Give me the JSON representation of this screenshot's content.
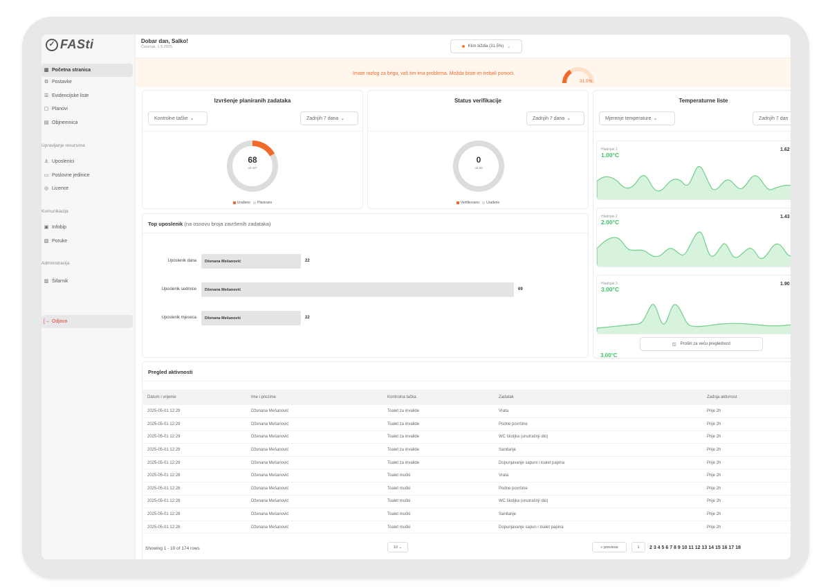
{
  "app": {
    "logo_text": "FASti",
    "logo_mark": "✓"
  },
  "sidebar": {
    "items": [
      {
        "label": "Početna stranica",
        "icon": "home-icon"
      },
      {
        "label": "Postavke",
        "icon": "gear-icon"
      },
      {
        "label": "Evidencijske liste",
        "icon": "list-icon"
      },
      {
        "label": "Planovi",
        "icon": "calendar-icon"
      },
      {
        "label": "Objnemnica",
        "icon": "document-icon"
      }
    ],
    "section_resources": "Upravljanje resursima",
    "resources": [
      {
        "label": "Uposlenici",
        "icon": "users-icon"
      },
      {
        "label": "Poslovne jedinice",
        "icon": "building-icon"
      },
      {
        "label": "Licence",
        "icon": "license-icon"
      }
    ],
    "section_comm": "Komunikacija",
    "comm": [
      {
        "label": "Infobip",
        "icon": "chat-icon"
      },
      {
        "label": "Poruke",
        "icon": "message-icon"
      }
    ],
    "section_admin": "Administracija",
    "admin": [
      {
        "label": "Šifarnik",
        "icon": "barcode-icon"
      }
    ],
    "logout": "Odjava"
  },
  "header": {
    "greeting": "Dobar dan, Salko!",
    "date": "Četvrtak, 1.5.2025.",
    "climate": "Klim tiiždia (31.5%)"
  },
  "alert": {
    "text": "Imate razlog za brigu, vaš tim ima problema. Možda biste im trebali pomoći.",
    "percent_label": "31.5%",
    "percent": 31.5,
    "color": "#f26a2a"
  },
  "card_tasks": {
    "title": "Izvršenje planiranih zadataka",
    "filter1": "Kontrolne tačke",
    "filter2": "Zadnjih 7 dana",
    "value": "68",
    "sub": "od 407",
    "done": 68,
    "total": 407,
    "legend1": "Urađeno",
    "legend2": "Planirano"
  },
  "card_verify": {
    "title": "Status verifikacije",
    "filter": "Zadnjih 7 dana",
    "value": "0",
    "sub": "od 68",
    "legend1": "Verifikovano",
    "legend2": "Urađeno"
  },
  "card_temp": {
    "title": "Temperaturne liste",
    "filter1": "Mjerenje temperature",
    "filter2": "Zadnjih 7 dan",
    "items": [
      {
        "label": "Hladnjak 1",
        "value": "1.00°C",
        "right": "1.62"
      },
      {
        "label": "Hladnjak 2",
        "value": "2.00°C",
        "right": "1.43"
      },
      {
        "label": "Hladnjak 3",
        "value": "3.00°C",
        "right": "1.90"
      }
    ],
    "expand": "Proširi za veću preglednost",
    "overflow": "3.00°C"
  },
  "top": {
    "title": "Top uposlenik",
    "subtitle": "(na osnovu broja završenih zadataka)",
    "rows": [
      {
        "label": "Uposlenik dana",
        "name": "Dženana Mešanović",
        "value": "22",
        "n": 22
      },
      {
        "label": "Uposlenik sedmice",
        "name": "Dženana Mešanović",
        "value": "69",
        "n": 69
      },
      {
        "label": "Uposlenik mjeseca",
        "name": "Dženana Mešanović",
        "value": "22",
        "n": 22
      }
    ]
  },
  "activity": {
    "title": "Pregled aktivnosti",
    "columns": [
      "Datum i vrijeme",
      "Ime i prezime",
      "Kontrolna tačka",
      "Zadatak",
      "Zadnja aktivnost"
    ],
    "rows": [
      [
        "2025-05-01 12:29",
        "Dženana Mešanović",
        "Toalet za invalide",
        "Vrata",
        "Prije 2h"
      ],
      [
        "2025-05-01 12:29",
        "Dženana Mešanović",
        "Toalet za invalide",
        "Podne površine",
        "Prije 2h"
      ],
      [
        "2025-05-01 12:29",
        "Dženana Mešanović",
        "Toalet za invalide",
        "WC školjka (unutrašnji dio)",
        "Prije 2h"
      ],
      [
        "2025-05-01 12:29",
        "Dženana Mešanović",
        "Toalet za invalide",
        "Sanitarije",
        "Prije 2h"
      ],
      [
        "2025-05-01 12:29",
        "Dženana Mešanović",
        "Toalet za invalide",
        "Dopunjavanje sapuni i toalet papina",
        "Prije 2h"
      ],
      [
        "2025-05-01 12:28",
        "Dženana Mešanović",
        "Toalet muški",
        "Vrata",
        "Prije 2h"
      ],
      [
        "2025-05-01 12:28",
        "Dženana Mešanović",
        "Toalet muški",
        "Podne površine",
        "Prije 2h"
      ],
      [
        "2025-05-01 12:28",
        "Dženana Mešanović",
        "Toalet muški",
        "WC školjka (unutrašnji dio)",
        "Prije 2h"
      ],
      [
        "2025-05-01 12:28",
        "Dženana Mešanović",
        "Toalet muški",
        "Sanitarije",
        "Prije 2h"
      ],
      [
        "2025-05-01 12:28",
        "Dženana Mešanović",
        "Toalet muški",
        "Dopunjavanje sapun i toalet papina",
        "Prije 2h"
      ]
    ],
    "showing": "Showing 1 - 10 of 174 rows",
    "page_size": "10",
    "prev": "« previous",
    "current_page": "1",
    "pages": "2 3 4 5 6 7 8 9 10 11 12 13 14 15 16 17 18"
  },
  "colors": {
    "accent": "#f26a2a",
    "green": "#3cc367",
    "gray_ring": "#dcdcdc"
  }
}
